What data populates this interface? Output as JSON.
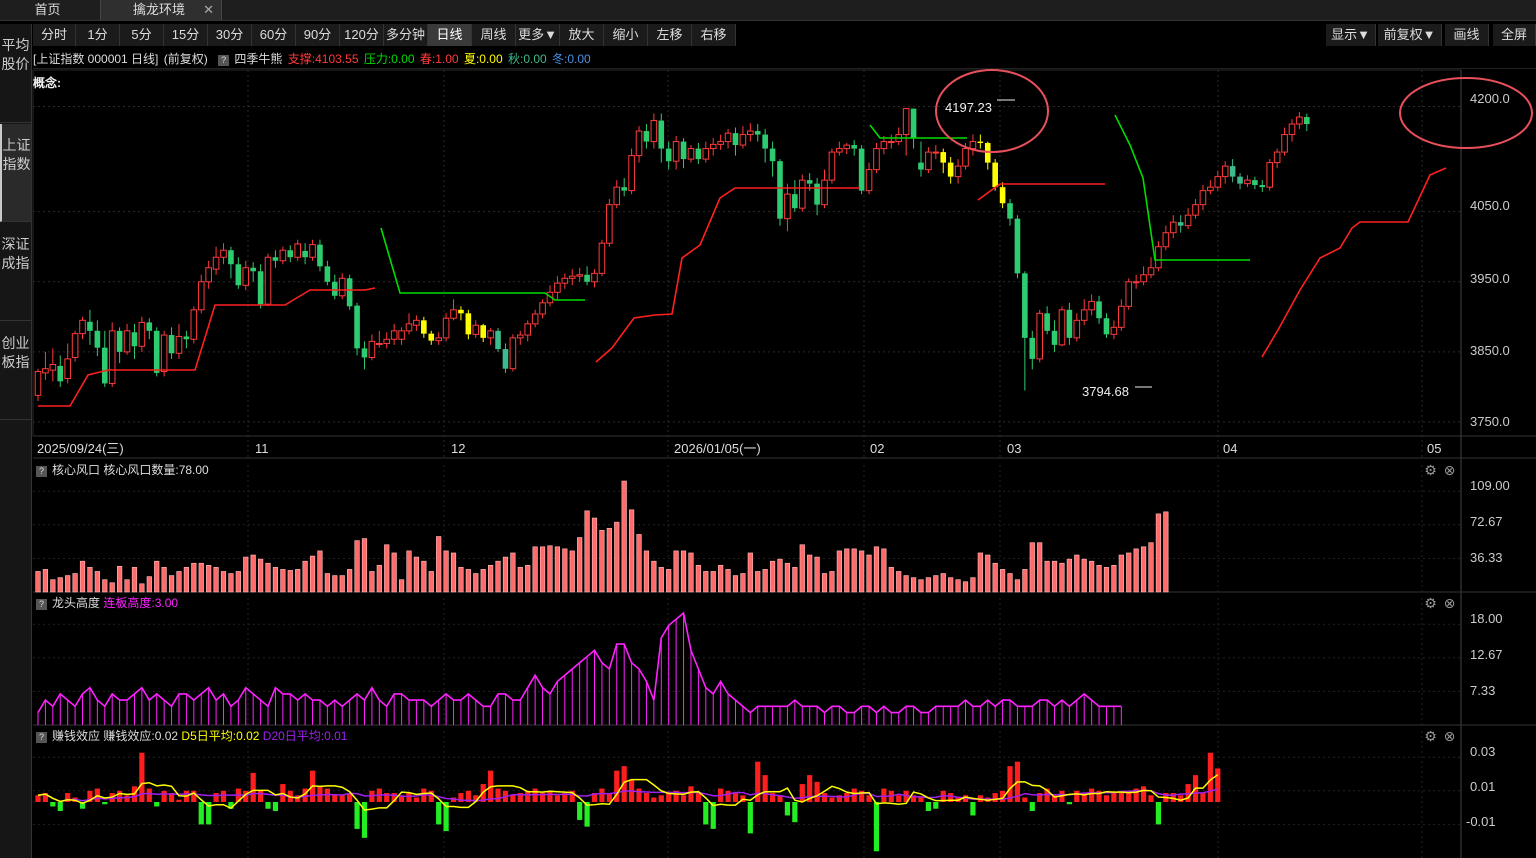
{
  "tabs": {
    "home": "首页",
    "active": "擒龙环境",
    "close": "✕"
  },
  "sidebar": [
    {
      "label": "平均股价"
    },
    {
      "label": "上证指数",
      "selected": true
    },
    {
      "label": "深证成指"
    },
    {
      "label": "创业板指"
    }
  ],
  "toolbar": {
    "left": [
      "分时",
      "1分",
      "5分",
      "15分",
      "30分",
      "60分",
      "90分",
      "120分",
      "多分钟",
      "日线",
      "周线",
      "更多▼",
      "放大",
      "缩小",
      "左移",
      "右移"
    ],
    "selected": "日线",
    "right": [
      "显示▼",
      "前复权▼",
      "画线",
      "全屏"
    ]
  },
  "info": {
    "security": "[上证指数 000001 日线]",
    "adjust": "(前复权)",
    "qmark": "?",
    "indicator": "四季牛熊",
    "support": "支撑:4103.55",
    "pressure": "压力:0.00",
    "spring": "春:1.00",
    "summer": "夏:0.00",
    "autumn": "秋:0.00",
    "winter": "冬:0.00"
  },
  "colors": {
    "up": "#ff3b3b",
    "down": "#2ecc71",
    "yellow": "#ffff00",
    "support": "#ff2020",
    "pressure": "#00dd00",
    "purple": "#ff22ff",
    "teal": "#3dbb8c"
  },
  "main_chart": {
    "concept_label": "概念:",
    "y_ticks": [
      "4200.0",
      "4050.0",
      "3950.0",
      "3850.0",
      "3750.0"
    ],
    "x_labels": [
      "2025/09/24(三)",
      "11",
      "12",
      "2026/01/05(一)",
      "02",
      "03",
      "04",
      "05"
    ],
    "annotations": {
      "high": "4197.23",
      "low": "3794.68"
    }
  },
  "panel2": {
    "title": "核心风口",
    "value": "核心风口数量:78.00",
    "y_ticks": [
      "109.00",
      "72.67",
      "36.33"
    ]
  },
  "panel3": {
    "title": "龙头高度",
    "value": "连板高度:3.00",
    "y_ticks": [
      "18.00",
      "12.67",
      "7.33"
    ]
  },
  "panel4": {
    "title": "赚钱效应",
    "value": "赚钱效应:0.02",
    "d5": "D5日平均:0.02",
    "d20": "D20日平均:0.01",
    "y_ticks": [
      "0.03",
      "0.01",
      "-0.01"
    ]
  },
  "chart_data": {
    "type": "candlestick",
    "title": "上证指数 000001 日线",
    "high_marker": 4197.23,
    "low_marker": 3794.68,
    "ylim": [
      3730,
      4215
    ],
    "panels": [
      {
        "name": "核心风口数量",
        "type": "bar",
        "ylim": [
          0,
          109
        ],
        "last": 78.0
      },
      {
        "name": "连板高度",
        "type": "line",
        "ylim": [
          0,
          18
        ],
        "last": 3.0
      },
      {
        "name": "赚钱效应",
        "type": "bar+line",
        "ylim": [
          -0.02,
          0.03
        ],
        "last": 0.02,
        "d5": 0.02,
        "d20": 0.01
      }
    ]
  }
}
